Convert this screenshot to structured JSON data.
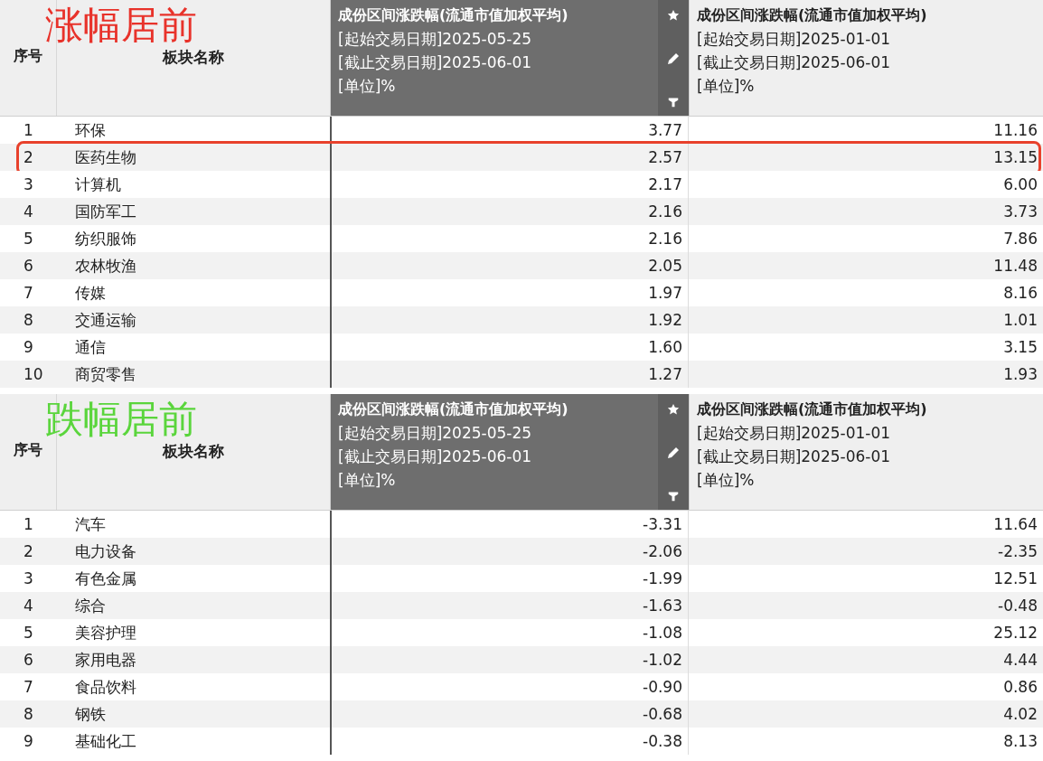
{
  "tables": [
    {
      "title": "涨幅居前",
      "color": "#e8322a",
      "columns": [
        {
          "kind": "index",
          "label": "序号"
        },
        {
          "kind": "name",
          "label": "板块名称"
        },
        {
          "kind": "metric",
          "selected": true,
          "lines": [
            "成份区间涨跌幅(流通市值加权平均)",
            "[起始交易日期]2025-05-25",
            "[截止交易日期]2025-06-01",
            "[单位]%"
          ]
        },
        {
          "kind": "metric",
          "selected": false,
          "lines": [
            "成份区间涨跌幅(流通市值加权平均)",
            "[起始交易日期]2025-01-01",
            "[截止交易日期]2025-06-01",
            "[单位]%"
          ]
        }
      ],
      "rows": [
        {
          "index": "1",
          "name": "环保",
          "values": [
            "3.77",
            "11.16"
          ],
          "highlighted": false
        },
        {
          "index": "2",
          "name": "医药生物",
          "values": [
            "2.57",
            "13.15"
          ],
          "highlighted": true
        },
        {
          "index": "3",
          "name": "计算机",
          "values": [
            "2.17",
            "6.00"
          ],
          "highlighted": false
        },
        {
          "index": "4",
          "name": "国防军工",
          "values": [
            "2.16",
            "3.73"
          ],
          "highlighted": false
        },
        {
          "index": "5",
          "name": "纺织服饰",
          "values": [
            "2.16",
            "7.86"
          ],
          "highlighted": false
        },
        {
          "index": "6",
          "name": "农林牧渔",
          "values": [
            "2.05",
            "11.48"
          ],
          "highlighted": false
        },
        {
          "index": "7",
          "name": "传媒",
          "values": [
            "1.97",
            "8.16"
          ],
          "highlighted": false
        },
        {
          "index": "8",
          "name": "交通运输",
          "values": [
            "1.92",
            "1.01"
          ],
          "highlighted": false
        },
        {
          "index": "9",
          "name": "通信",
          "values": [
            "1.60",
            "3.15"
          ],
          "highlighted": false
        },
        {
          "index": "10",
          "name": "商贸零售",
          "values": [
            "1.27",
            "1.93"
          ],
          "highlighted": false
        }
      ]
    },
    {
      "title": "跌幅居前",
      "color": "#5ad53c",
      "columns": [
        {
          "kind": "index",
          "label": "序号"
        },
        {
          "kind": "name",
          "label": "板块名称"
        },
        {
          "kind": "metric",
          "selected": true,
          "lines": [
            "成份区间涨跌幅(流通市值加权平均)",
            "[起始交易日期]2025-05-25",
            "[截止交易日期]2025-06-01",
            "[单位]%"
          ]
        },
        {
          "kind": "metric",
          "selected": false,
          "lines": [
            "成份区间涨跌幅(流通市值加权平均)",
            "[起始交易日期]2025-01-01",
            "[截止交易日期]2025-06-01",
            "[单位]%"
          ]
        }
      ],
      "rows": [
        {
          "index": "1",
          "name": "汽车",
          "values": [
            "-3.31",
            "11.64"
          ],
          "highlighted": false
        },
        {
          "index": "2",
          "name": "电力设备",
          "values": [
            "-2.06",
            "-2.35"
          ],
          "highlighted": false
        },
        {
          "index": "3",
          "name": "有色金属",
          "values": [
            "-1.99",
            "12.51"
          ],
          "highlighted": false
        },
        {
          "index": "4",
          "name": "综合",
          "values": [
            "-1.63",
            "-0.48"
          ],
          "highlighted": false
        },
        {
          "index": "5",
          "name": "美容护理",
          "values": [
            "-1.08",
            "25.12"
          ],
          "highlighted": false
        },
        {
          "index": "6",
          "name": "家用电器",
          "values": [
            "-1.02",
            "4.44"
          ],
          "highlighted": false
        },
        {
          "index": "7",
          "name": "食品饮料",
          "values": [
            "-0.90",
            "0.86"
          ],
          "highlighted": false
        },
        {
          "index": "8",
          "name": "钢铁",
          "values": [
            "-0.68",
            "4.02"
          ],
          "highlighted": false
        },
        {
          "index": "9",
          "name": "基础化工",
          "values": [
            "-0.38",
            "8.13"
          ],
          "highlighted": false
        }
      ]
    }
  ]
}
